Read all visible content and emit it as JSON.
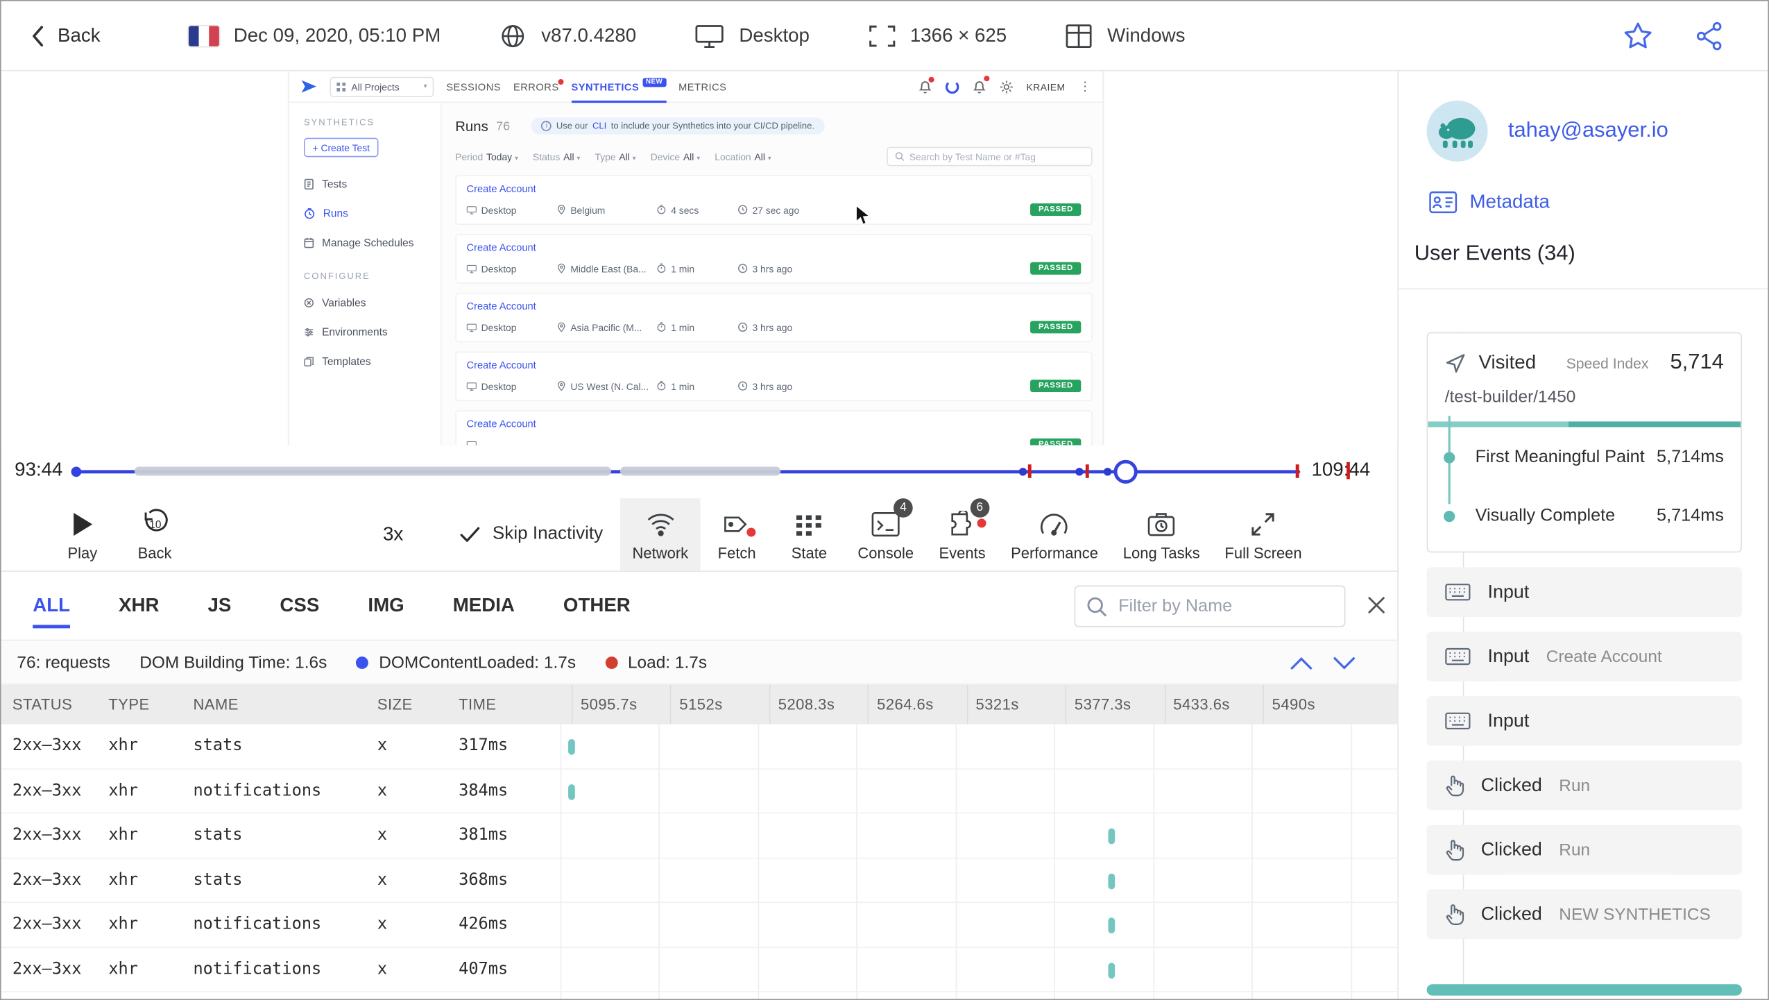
{
  "accent": "#3a52ee",
  "topbar": {
    "back_label": "Back",
    "session_date": "Dec 09, 2020, 05:10 PM",
    "browser_version": "v87.0.4280",
    "device_type": "Desktop",
    "resolution": "1366 × 625",
    "os": "Windows"
  },
  "replay_app": {
    "nav": {
      "project_selector": "All Projects",
      "tabs": [
        {
          "label": "SESSIONS"
        },
        {
          "label": "ERRORS"
        },
        {
          "label": "SYNTHETICS",
          "badge": "NEW"
        },
        {
          "label": "METRICS"
        }
      ],
      "user_name": "KRAIEM"
    },
    "sidebar": {
      "section_title": "SYNTHETICS",
      "create_button": "+ Create Test",
      "items": [
        {
          "label": "Tests"
        },
        {
          "label": "Runs"
        },
        {
          "label": "Manage Schedules"
        }
      ],
      "configure_title": "CONFIGURE",
      "configure_items": [
        {
          "label": "Variables"
        },
        {
          "label": "Environments"
        },
        {
          "label": "Templates"
        }
      ]
    },
    "content": {
      "title": "Runs",
      "count": "76",
      "banner_prefix": "Use our",
      "banner_link": "CLI",
      "banner_suffix": "to include your Synthetics into your CI/CD pipeline.",
      "filters": [
        {
          "label": "Period",
          "value": "Today"
        },
        {
          "label": "Status",
          "value": "All"
        },
        {
          "label": "Type",
          "value": "All"
        },
        {
          "label": "Device",
          "value": "All"
        },
        {
          "label": "Location",
          "value": "All"
        }
      ],
      "search_placeholder": "Search by Test Name or #Tag",
      "runs": [
        {
          "name": "Create Account",
          "device": "Desktop",
          "location": "Belgium",
          "duration": "4 secs",
          "ago": "27 sec ago",
          "status": "PASSED"
        },
        {
          "name": "Create Account",
          "device": "Desktop",
          "location": "Middle East (Ba...",
          "duration": "1 min",
          "ago": "3 hrs ago",
          "status": "PASSED"
        },
        {
          "name": "Create Account",
          "device": "Desktop",
          "location": "Asia Pacific (M...",
          "duration": "1 min",
          "ago": "3 hrs ago",
          "status": "PASSED"
        },
        {
          "name": "Create Account",
          "device": "Desktop",
          "location": "US West (N. Cal...",
          "duration": "1 min",
          "ago": "3 hrs ago",
          "status": "PASSED"
        },
        {
          "name": "Create Account",
          "device": "",
          "location": "",
          "duration": "",
          "ago": "",
          "status": "PASSED"
        }
      ]
    }
  },
  "timeline": {
    "current_time": "93:44",
    "end_time": "109:44"
  },
  "player": {
    "play_label": "Play",
    "back_label": "Back",
    "speed": "3x",
    "skip_inactivity_label": "Skip Inactivity",
    "panels": [
      {
        "label": "Network"
      },
      {
        "label": "Fetch"
      },
      {
        "label": "State"
      },
      {
        "label": "Console",
        "badge": "4"
      },
      {
        "label": "Events",
        "badge": "6"
      },
      {
        "label": "Performance"
      },
      {
        "label": "Long Tasks"
      },
      {
        "label": "Full Screen"
      }
    ]
  },
  "network_panel": {
    "tabs": [
      {
        "label": "ALL"
      },
      {
        "label": "XHR"
      },
      {
        "label": "JS"
      },
      {
        "label": "CSS"
      },
      {
        "label": "IMG"
      },
      {
        "label": "MEDIA"
      },
      {
        "label": "OTHER"
      }
    ],
    "filter_placeholder": "Filter by Name",
    "summary": {
      "requests": "76: requests",
      "dom_building": "DOM Building Time: 1.6s",
      "dom_content_loaded": "DOMContentLoaded: 1.7s",
      "load": "Load: 1.7s"
    },
    "columns": [
      "STATUS",
      "TYPE",
      "NAME",
      "SIZE",
      "TIME"
    ],
    "time_columns": [
      "5095.7s",
      "5152s",
      "5208.3s",
      "5264.6s",
      "5321s",
      "5377.3s",
      "5433.6s",
      "5490s"
    ],
    "rows": [
      {
        "status": "2xx–3xx",
        "type": "xhr",
        "name": "stats",
        "size": "x",
        "time": "317ms",
        "bar_col": 0,
        "bar_frac": 0.08
      },
      {
        "status": "2xx–3xx",
        "type": "xhr",
        "name": "notifications",
        "size": "x",
        "time": "384ms",
        "bar_col": 0,
        "bar_frac": 0.08
      },
      {
        "status": "2xx–3xx",
        "type": "xhr",
        "name": "stats",
        "size": "x",
        "time": "381ms",
        "bar_col": 5,
        "bar_frac": 0.55
      },
      {
        "status": "2xx–3xx",
        "type": "xhr",
        "name": "stats",
        "size": "x",
        "time": "368ms",
        "bar_col": 5,
        "bar_frac": 0.55
      },
      {
        "status": "2xx–3xx",
        "type": "xhr",
        "name": "notifications",
        "size": "x",
        "time": "426ms",
        "bar_col": 5,
        "bar_frac": 0.55
      },
      {
        "status": "2xx–3xx",
        "type": "xhr",
        "name": "notifications",
        "size": "x",
        "time": "407ms",
        "bar_col": 5,
        "bar_frac": 0.55
      }
    ]
  },
  "user_panel": {
    "email": "tahay@asayer.io",
    "metadata_label": "Metadata",
    "events_title": "User Events (34)",
    "visited": {
      "label": "Visited",
      "speed_index_label": "Speed Index",
      "speed_index": "5,714",
      "url": "/test-builder/1450",
      "metrics": [
        {
          "label": "First Meaningful Paint",
          "value": "5,714ms"
        },
        {
          "label": "Visually Complete",
          "value": "5,714ms"
        }
      ]
    },
    "events": [
      {
        "kind": "input",
        "label": "Input",
        "detail": ""
      },
      {
        "kind": "input",
        "label": "Input",
        "detail": "Create Account"
      },
      {
        "kind": "input",
        "label": "Input",
        "detail": ""
      },
      {
        "kind": "click",
        "label": "Clicked",
        "detail": "Run"
      },
      {
        "kind": "click",
        "label": "Clicked",
        "detail": "Run"
      },
      {
        "kind": "click",
        "label": "Clicked",
        "detail": "NEW SYNTHETICS"
      }
    ]
  },
  "icons": {
    "back": "chevron-left",
    "flag": "france-flag",
    "browser": "globe",
    "device": "monitor",
    "resolution": "frame-corners",
    "os": "window-panes",
    "favorite": "star-outline",
    "share": "share-nodes",
    "play": "triangle-right",
    "rewind": "rotate-ccw-10",
    "skip": "checkmark",
    "network": "wifi-signal",
    "fetch": "tag",
    "state": "grid-squares",
    "console": "terminal",
    "events": "puzzle",
    "performance": "gauge",
    "long_tasks": "clock-case",
    "full_screen": "expand-arrows",
    "filter": "magnifier",
    "close": "x-cross",
    "sort": "chevron-up-down",
    "visited": "location-arrow",
    "input": "keyboard",
    "clicked": "hand-pointer",
    "metadata": "id-card",
    "avatar": "hippo"
  }
}
